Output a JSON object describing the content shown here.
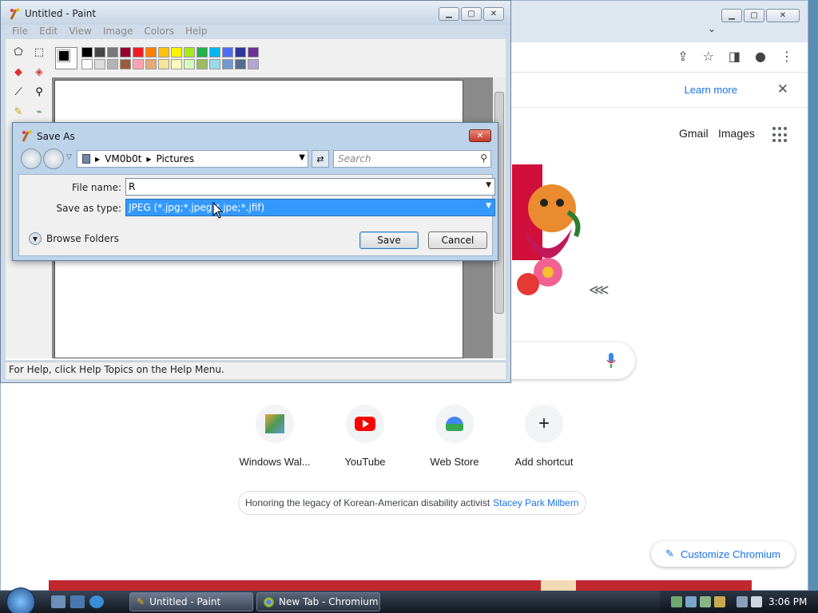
{
  "chromium": {
    "learn_more": "Learn more",
    "links": {
      "gmail": "Gmail",
      "images": "Images"
    },
    "shortcuts": [
      {
        "label": "Windows Wal..."
      },
      {
        "label": "YouTube"
      },
      {
        "label": "Web Store"
      },
      {
        "label": "Add shortcut"
      }
    ],
    "legacy_text": "Honoring the legacy of Korean-American disability activist",
    "legacy_link": "Stacey Park Milbern",
    "customize_label": "Customize Chromium"
  },
  "paint": {
    "title": "Untitled - Paint",
    "menu": [
      "File",
      "Edit",
      "View",
      "Image",
      "Colors",
      "Help"
    ],
    "status": "For Help, click Help Topics on the Help Menu.",
    "palette_top": [
      "#000000",
      "#464646",
      "#787878",
      "#990030",
      "#ed1c24",
      "#ff7e00",
      "#ffc20e",
      "#fff200",
      "#a8e61d",
      "#22b14c",
      "#00b7ef",
      "#4d6df3",
      "#2f3699",
      "#6f3198"
    ],
    "palette_bottom": [
      "#ffffff",
      "#dcdcdc",
      "#b4b4b4",
      "#9c5a3c",
      "#ffa3b1",
      "#e5aa7a",
      "#f5e49c",
      "#fff9bd",
      "#d3f9bc",
      "#9dbb61",
      "#99d9ea",
      "#709ad1",
      "#546d8e",
      "#b5a5d5"
    ]
  },
  "save_as": {
    "title": "Save As",
    "path": [
      "VM0b0t",
      "Pictures"
    ],
    "search_placeholder": "Search",
    "file_name_label": "File name:",
    "file_name_value": "R",
    "save_type_label": "Save as type:",
    "save_type_value": "JPEG (*.jpg;*.jpeg;*.jpe;*.jfif)",
    "browse_folders": "Browse Folders",
    "save_button": "Save",
    "cancel_button": "Cancel"
  },
  "taskbar": {
    "tasks": [
      "Untitled - Paint",
      "New Tab - Chromium"
    ],
    "clock": "3:06 PM"
  }
}
